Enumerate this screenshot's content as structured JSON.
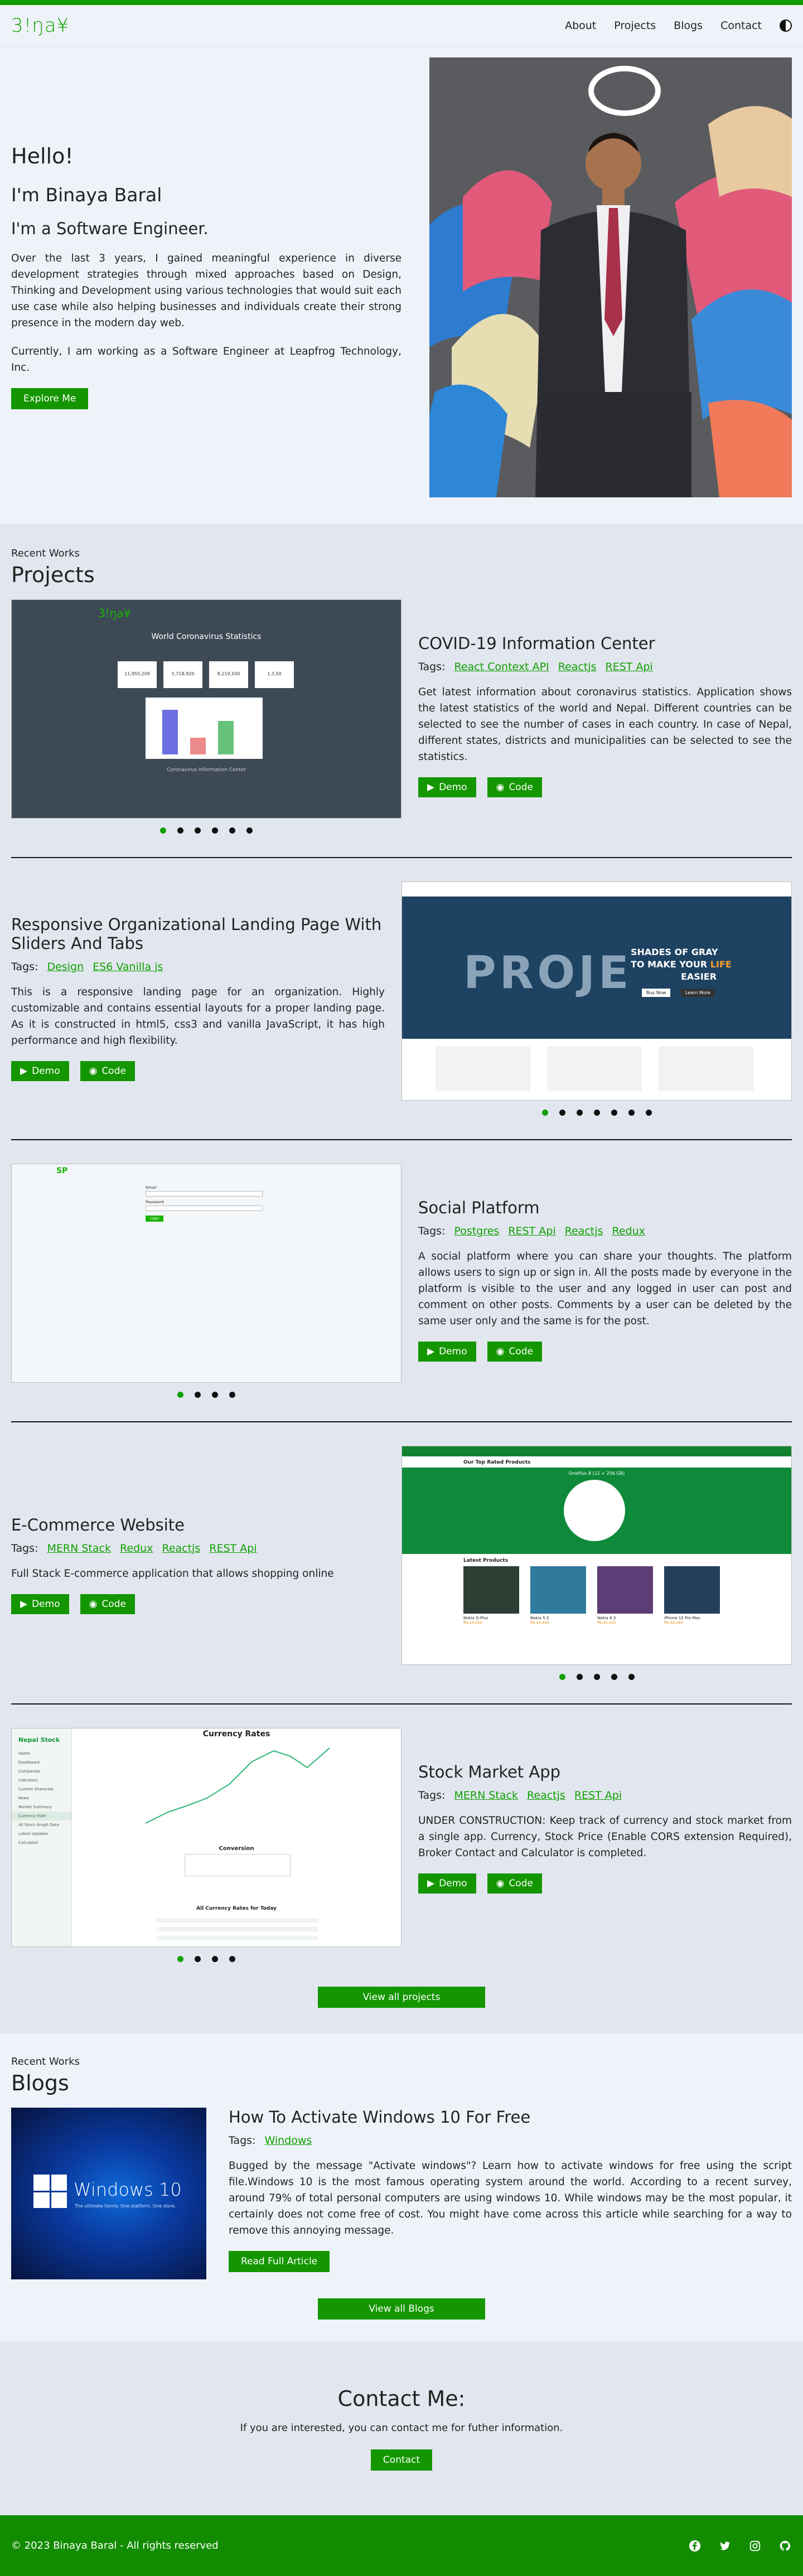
{
  "header": {
    "logo": "3!ŋa¥",
    "nav": [
      {
        "label": "About"
      },
      {
        "label": "Projects"
      },
      {
        "label": "Blogs"
      },
      {
        "label": "Contact"
      }
    ],
    "theme_icon": "half-moon-icon"
  },
  "hero": {
    "greeting": "Hello!",
    "name": "I'm Binaya Baral",
    "role": "I'm a Software Engineer.",
    "paragraph1": "Over the last 3 years, I gained meaningful experience in diverse development strategies through mixed approaches based on Design, Thinking and Development using various technologies that would suit each use case while also helping businesses and individuals create their strong presence in the modern day web.",
    "paragraph2": "Currently, I am working as a Software Engineer at Leapfrog Technology, Inc.",
    "cta": "Explore Me"
  },
  "projects": {
    "eyebrow": "Recent Works",
    "title": "Projects",
    "items": [
      {
        "title": "COVID-19 Information Center",
        "tags_label": "Tags:",
        "tags": [
          "React Context API",
          "Reactjs",
          "REST Api"
        ],
        "description": "Get latest information about coronavirus statistics. Application shows the latest statistics of the world and Nepal. Different countries can be selected to see the number of cases in each country. In case of Nepal, different states, districts and municipalities can be selected to see the statistics.",
        "demo": "Demo",
        "code": "Code",
        "shot": {
          "logo": "3!ŋa¥",
          "title": "World Coronavirus Statistics",
          "stats": [
            "11,955,209",
            "5,718,920",
            "8,219,500",
            "1,3,50"
          ],
          "footer": "Coronavirus Information Center"
        }
      },
      {
        "title": "Responsive Organizational Landing Page With Sliders And Tabs",
        "tags_label": "Tags:",
        "tags": [
          "Design",
          "ES6 Vanilla js"
        ],
        "description": "This is a responsive landing page for an organization. Highly customizable and contains essential layouts for a proper landing page. As it is constructed in html5, css3 and vanilla JavaScript, it has high performance and high flexibility.",
        "demo": "Demo",
        "code": "Code",
        "shot": {
          "banner_word": "PROJE",
          "line1": "SHADES OF GRAY",
          "line2a": "TO MAKE YOUR ",
          "line2b": "LIFE",
          "line3": "EASIER",
          "btn1": "Buy Now",
          "btn2": "Learn More"
        }
      },
      {
        "title": "Social Platform",
        "tags_label": "Tags:",
        "tags": [
          "Postgres",
          "REST Api",
          "Reactjs",
          "Redux"
        ],
        "description": "A social platform where you can share your thoughts. The platform allows users to sign up or sign in. All the posts made by everyone in the platform is visible to the user and any logged in user can post and comment on other posts. Comments by a user can be deleted by the same user only and the same is for the post.",
        "demo": "Demo",
        "code": "Code",
        "shot": {
          "logo": "SP",
          "email": "Email",
          "password": "Password",
          "login": "Login"
        }
      },
      {
        "title": "E-Commerce Website",
        "tags_label": "Tags:",
        "tags": [
          "MERN Stack",
          "Redux",
          "Reactjs",
          "REST Api"
        ],
        "description": "Full Stack E-commerce application that allows shopping online",
        "demo": "Demo",
        "code": "Code",
        "shot": {
          "top_rated": "Our Top Rated Products",
          "hero_product": "OnePlus 8 (12 + 256 GB)",
          "latest": "Latest Products",
          "products": [
            {
              "name": "Nokia G-Plus",
              "price": "Rs.xx,xxx"
            },
            {
              "name": "Nokia 5.3",
              "price": "Rs.xx,xxx"
            },
            {
              "name": "Nokia 8.3",
              "price": "Rs.xx,xxx"
            },
            {
              "name": "iPhone 12 Pro Max",
              "price": "Rs.xx,xxx"
            }
          ]
        }
      },
      {
        "title": "Stock Market App",
        "tags_label": "Tags:",
        "tags": [
          "MERN Stack",
          "Reactjs",
          "REST Api"
        ],
        "description": "UNDER CONSTRUCTION: Keep track of currency and stock market from a single app. Currency, Stock Price (Enable CORS extension Required), Broker Contact and Calculator is completed.",
        "demo": "Demo",
        "code": "Code",
        "shot": {
          "brand": "Nepal Stock",
          "title": "Currency Rates",
          "conversion": "Conversion",
          "all_rates": "All Currency Rates for Today",
          "menu": [
            "Home",
            "Dashboard",
            "Companies",
            "Indicators",
            "Current Sharerate",
            "News",
            "Market Summary",
            "Currency Rate",
            "All Stock Graph Data",
            "Latest Updates",
            "Calculator"
          ]
        }
      }
    ],
    "view_all": "View all projects"
  },
  "blogs": {
    "eyebrow": "Recent Works",
    "title": "Blogs",
    "post": {
      "title": "How To Activate Windows 10 For Free",
      "tags_label": "Tags:",
      "tags": [
        "Windows"
      ],
      "excerpt": "Bugged by the message \"Activate windows\"? Learn how to activate windows for free using the script file.Windows 10 is the most famous operating system around the world. According to a recent survey, around 79% of total personal computers are using windows 10. While windows may be the most popular, it certainly does not come free of cost. You might have come across this article while searching for a way to remove this annoying message.",
      "read_more": "Read Full Article",
      "image_text": "Windows 10",
      "image_sub": "The ultimate family. One platform. One store."
    },
    "view_all": "View all Blogs"
  },
  "contact": {
    "title": "Contact Me:",
    "text": "If you are interested, you can contact me for futher information.",
    "button": "Contact"
  },
  "footer": {
    "copyright": "© 2023 Binaya Baral - All rights reserved",
    "icons": [
      "facebook-icon",
      "twitter-icon",
      "instagram-icon",
      "github-icon"
    ]
  },
  "colors": {
    "accent": "#149600",
    "footer": "#128b00",
    "link": "#10a000"
  }
}
